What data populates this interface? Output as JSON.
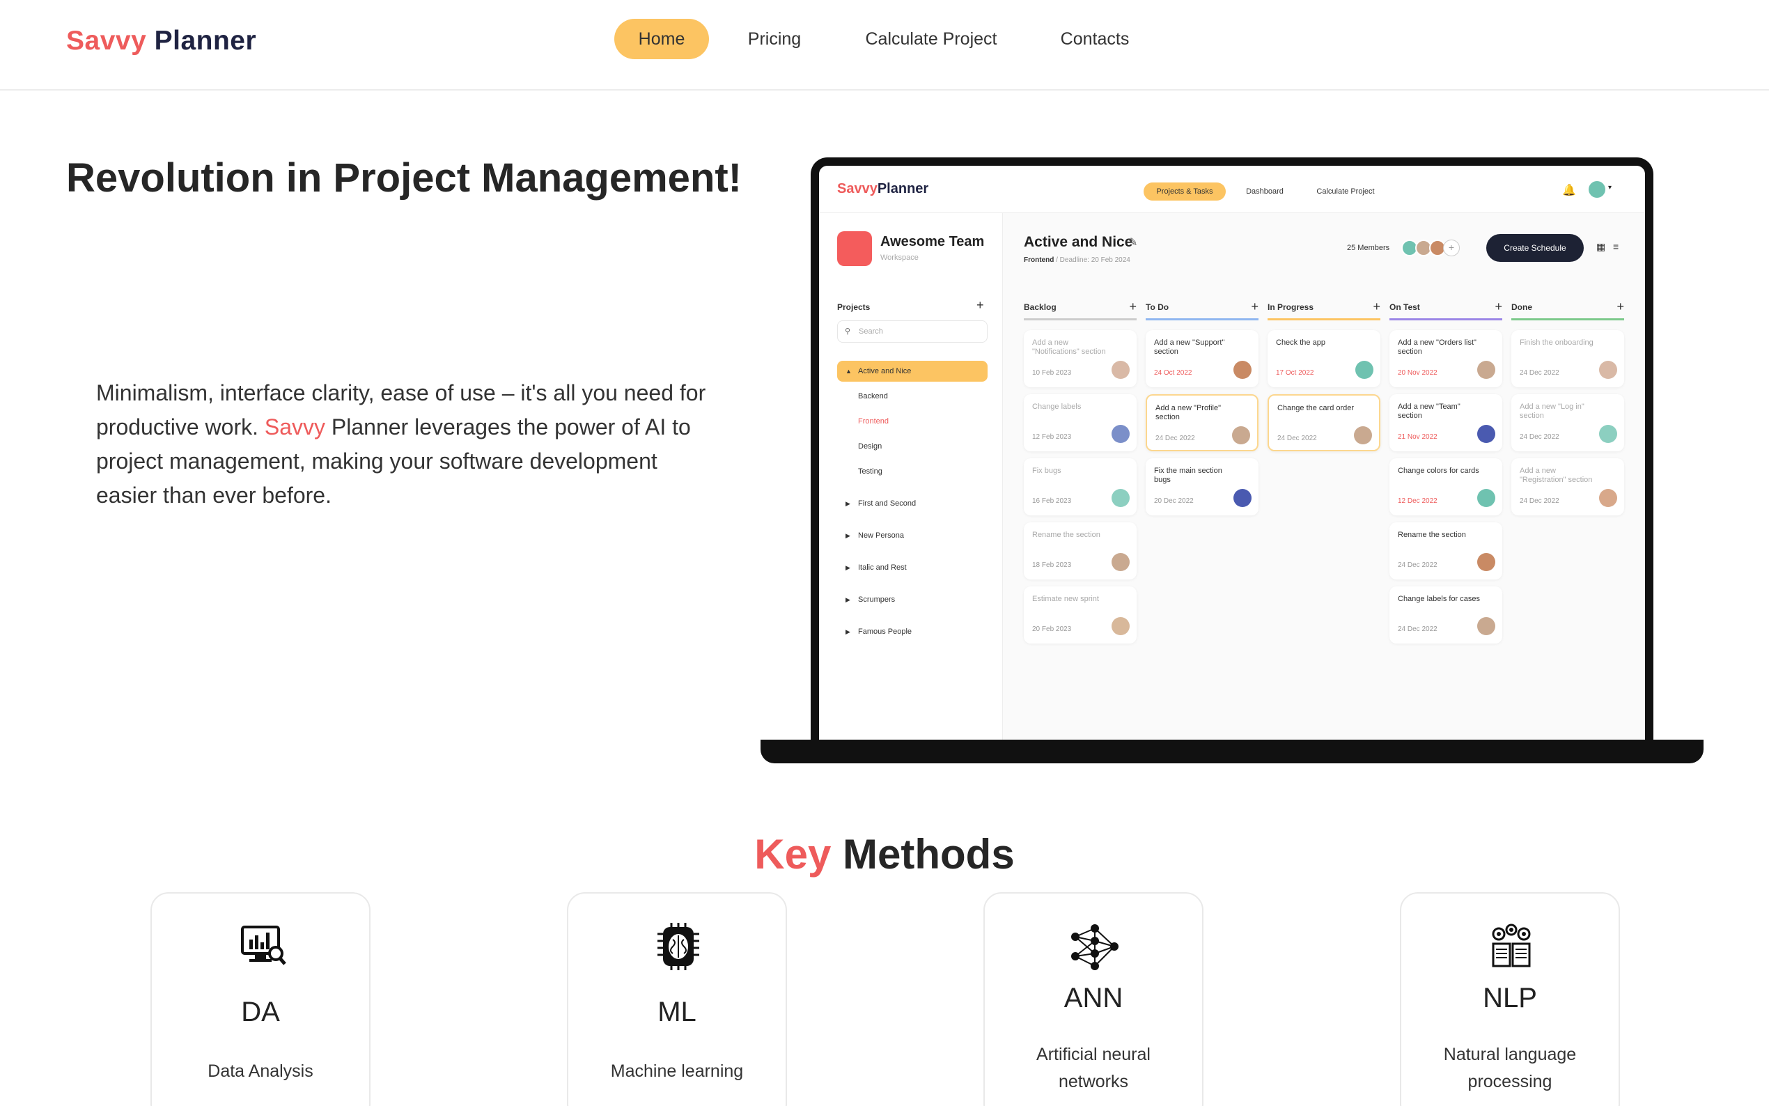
{
  "brand": {
    "first": "Savvy",
    "second": "Planner"
  },
  "nav": {
    "home": "Home",
    "pricing": "Pricing",
    "calculate": "Calculate Project",
    "contacts": "Contacts"
  },
  "hero": {
    "title": "Revolution in Project Management!",
    "text_before": "Minimalism, interface clarity, ease of use – it's all you need for productive work. ",
    "text_accent": "Savvy",
    "text_after": " Planner leverages the power of AI to project management, making your software development easier than ever before."
  },
  "app": {
    "nav": {
      "projects_tasks": "Projects & Tasks",
      "dashboard": "Dashboard",
      "calculate": "Calculate Project"
    },
    "team": {
      "name": "Awesome Team",
      "subtitle": "Workspace"
    },
    "projects_title": "Projects",
    "search_placeholder": "Search",
    "projects": {
      "active": "Active and Nice",
      "backend": "Backend",
      "frontend": "Frontend",
      "design": "Design",
      "testing": "Testing",
      "first_second": "First and Second",
      "new_persona": "New Persona",
      "italic_rest": "Italic and Rest",
      "scrumpers": "Scrumpers",
      "famous": "Famous People"
    },
    "board": {
      "title": "Active and Nice",
      "sub_label": "Frontend",
      "sub_deadline": " / Deadline: 20 Feb 2024",
      "members": "25 Members",
      "create": "Create Schedule"
    },
    "columns": [
      {
        "name": "Backlog",
        "color": "#cccccc",
        "cards": [
          {
            "title": "Add a new \"Notifications\" section",
            "date": "10 Feb 2023",
            "muted": true,
            "red": false,
            "hl": false,
            "av": "#d9b9a6"
          },
          {
            "title": "Change labels",
            "date": "12 Feb 2023",
            "muted": true,
            "red": false,
            "hl": false,
            "av": "#7b8fc9"
          },
          {
            "title": "Fix bugs",
            "date": "16 Feb 2023",
            "muted": true,
            "red": false,
            "hl": false,
            "av": "#8ccfc0"
          },
          {
            "title": "Rename the section",
            "date": "18 Feb 2023",
            "muted": true,
            "red": false,
            "hl": false,
            "av": "#c9a990"
          },
          {
            "title": "Estimate new sprint",
            "date": "20 Feb 2023",
            "muted": true,
            "red": false,
            "hl": false,
            "av": "#d8b89a"
          }
        ]
      },
      {
        "name": "To Do",
        "color": "#8fb6f0",
        "cards": [
          {
            "title": "Add a new \"Support\" section",
            "date": "24 Oct 2022",
            "muted": false,
            "red": true,
            "hl": false,
            "av": "#c98a64"
          },
          {
            "title": "Add a new \"Profile\" section",
            "date": "24 Dec 2022",
            "muted": false,
            "red": false,
            "hl": true,
            "av": "#c9a990"
          },
          {
            "title": "Fix the main section bugs",
            "date": "20 Dec 2022",
            "muted": false,
            "red": false,
            "hl": false,
            "av": "#4a5ab0"
          }
        ]
      },
      {
        "name": "In Progress",
        "color": "#fcc462",
        "cards": [
          {
            "title": "Check the app",
            "date": "17 Oct 2022",
            "muted": false,
            "red": true,
            "hl": false,
            "av": "#6fc2b0"
          },
          {
            "title": "Change the card order",
            "date": "24 Dec 2022",
            "muted": false,
            "red": false,
            "hl": true,
            "av": "#c9a990"
          }
        ]
      },
      {
        "name": "On Test",
        "color": "#9b86e6",
        "cards": [
          {
            "title": "Add a new \"Orders list\" section",
            "date": "20 Nov 2022",
            "muted": false,
            "red": true,
            "hl": false,
            "av": "#c9a990"
          },
          {
            "title": "Add a new \"Team\" section",
            "date": "21 Nov 2022",
            "muted": false,
            "red": true,
            "hl": false,
            "av": "#4a5ab0"
          },
          {
            "title": "Change colors for cards",
            "date": "12 Dec 2022",
            "muted": false,
            "red": true,
            "hl": false,
            "av": "#6fc2b0"
          },
          {
            "title": "Rename the section",
            "date": "24 Dec 2022",
            "muted": false,
            "red": false,
            "hl": false,
            "av": "#c98a64"
          },
          {
            "title": "Change labels for cases",
            "date": "24 Dec 2022",
            "muted": false,
            "red": false,
            "hl": false,
            "av": "#c9a990"
          }
        ]
      },
      {
        "name": "Done",
        "color": "#7cc98a",
        "cards": [
          {
            "title": "Finish the onboarding",
            "date": "24 Dec 2022",
            "muted": true,
            "red": false,
            "hl": false,
            "av": "#d9b9a6"
          },
          {
            "title": "Add a new \"Log in\" section",
            "date": "24 Dec 2022",
            "muted": true,
            "red": false,
            "hl": false,
            "av": "#8ccfc0"
          },
          {
            "title": "Add a new \"Registration\" section",
            "date": "24 Dec 2022",
            "muted": true,
            "red": false,
            "hl": false,
            "av": "#d8a88a"
          }
        ]
      }
    ]
  },
  "methods": {
    "title_accent": "Key",
    "title_rest": " Methods",
    "items": [
      {
        "abbr": "DA",
        "name": "Data Analysis",
        "icon": "data-analysis-icon"
      },
      {
        "abbr": "ML",
        "name": "Machine learning",
        "icon": "chip-brain-icon"
      },
      {
        "abbr": "ANN",
        "name": "Artificial neural networks",
        "icon": "neural-network-icon"
      },
      {
        "abbr": "NLP",
        "name": "Natural language processing",
        "icon": "book-gears-icon"
      }
    ]
  },
  "colors": {
    "accent": "#ee5b5b",
    "highlight": "#fcc462",
    "dark": "#1d2234"
  }
}
